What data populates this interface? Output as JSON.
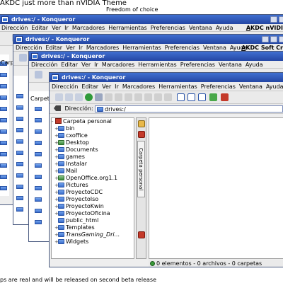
{
  "header": {
    "title": "AKDC just more than nVIDIA Theme",
    "subtitle": "Freedom of choice"
  },
  "footer": {
    "note": "ps are real and will be released on second beta release"
  },
  "windows": {
    "back": {
      "title": "drives:/ - Konqueror",
      "menu": [
        "Dirección",
        "Editar",
        "Ver",
        "Ir",
        "Marcadores",
        "Herramientas",
        "Preferencias",
        "Ventana",
        "Ayuda"
      ],
      "brand": "AKDC nVIDI"
    },
    "middle": {
      "title": "drives:/ - Konqueror",
      "menu": [
        "Dirección",
        "Editar",
        "Ver",
        "Ir",
        "Marcadores",
        "Herramientas",
        "Preferencias",
        "Ventana",
        "Ayuda"
      ],
      "brand": "AKDC Soft Cr"
    },
    "third": {
      "title": "drives:/ - Konqueror",
      "menu": [
        "Dirección",
        "Editar",
        "Ver",
        "Ir",
        "Marcadores",
        "Herramientas",
        "Preferencias",
        "Ventana",
        "Ayuda"
      ]
    },
    "front": {
      "title": "drives:/ - Konqueror",
      "menu": [
        "Dirección",
        "Editar",
        "Ver",
        "Ir",
        "Marcadores",
        "Herramientas",
        "Preferencias",
        "Ventana",
        "Ayuda"
      ],
      "location_label": "Dirección:",
      "location_value": "drives:/",
      "sidebar_tab": "Carpeta personal",
      "tree": {
        "root": "Carpeta personal",
        "items": [
          "bin",
          "cxoffice",
          "Desktop",
          "Documents",
          "games",
          "Instalar",
          "Mail",
          "OpenOffice.org1.1",
          "Pictures",
          "ProyectoCDC",
          "ProyectoIso",
          "ProyectoKwin",
          "ProyectoOficina",
          "public_html",
          "Templates",
          "TransGaming_Dri...",
          "Widgets"
        ]
      },
      "status": "0 elementos - 0 archivos - 0 carpetas"
    }
  },
  "partial": {
    "third_root": "Carpeta pe",
    "back_root": "Carpe"
  },
  "colors": {
    "titlebar": "#2f5ac0",
    "folder": "#3a6dcc",
    "accent": "#c43a2a"
  }
}
